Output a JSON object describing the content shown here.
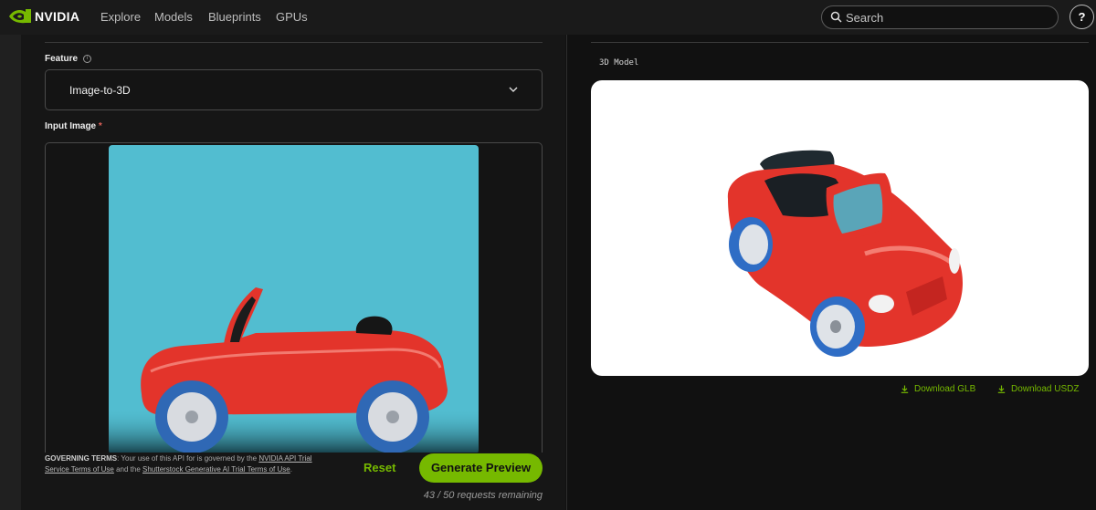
{
  "nav": {
    "brand": "NVIDIA",
    "links": [
      "Explore",
      "Models",
      "Blueprints",
      "GPUs"
    ],
    "search_placeholder": "Search",
    "help_label": "?"
  },
  "left": {
    "feature_label": "Feature",
    "feature_value": "Image-to-3D",
    "input_image_label": "Input Image",
    "required_mark": "*",
    "terms": {
      "heading": "GOVERNING TERMS",
      "text1": ": Your use of this API for is governed by the ",
      "link1": "NVIDIA API Trial Service Terms of Use",
      "text2": " and the ",
      "link2": "Shutterstock Generative AI Trial Terms of Use",
      "text3": "."
    },
    "reset_label": "Reset",
    "generate_label": "Generate Preview",
    "requests_remaining": "43 / 50 requests remaining"
  },
  "right": {
    "output_label": "3D Model",
    "download_glb": "Download GLB",
    "download_usdz": "Download USDZ"
  },
  "colors": {
    "accent": "#76b900",
    "input_bg": "#52bdd0",
    "car_red": "#e3342b",
    "wheel_blue": "#2f68b5"
  }
}
